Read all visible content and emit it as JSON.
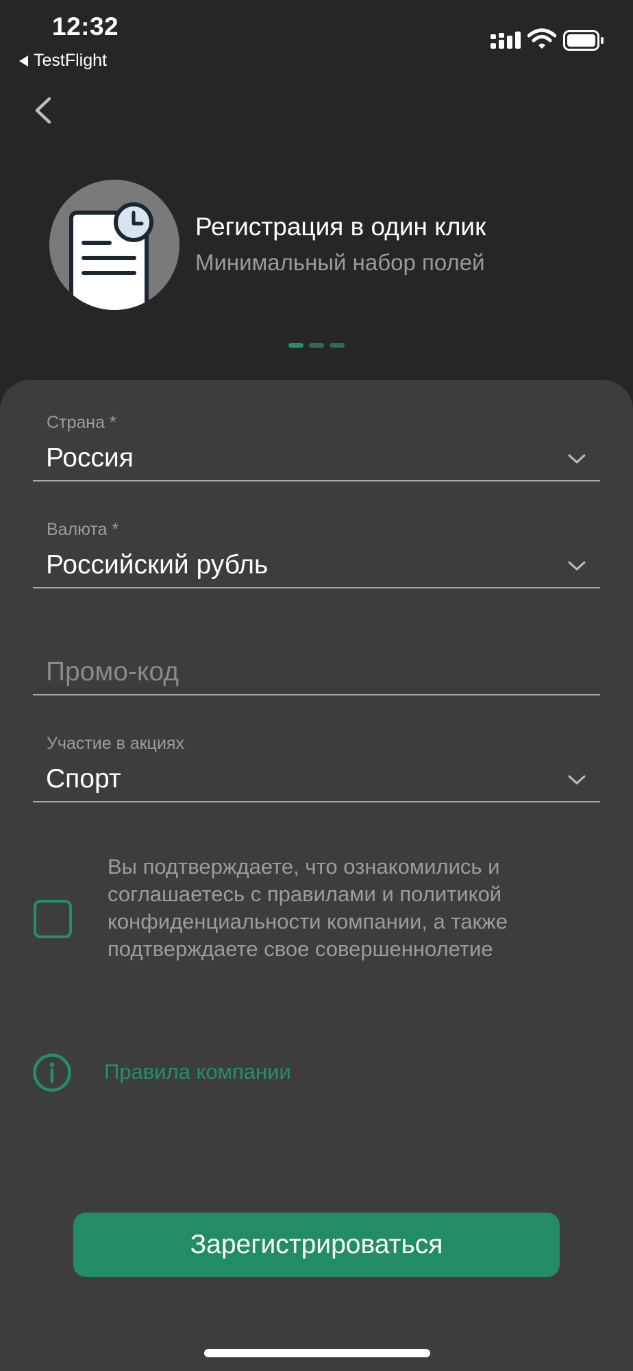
{
  "status_bar": {
    "time": "12:32",
    "back_app_label": "TestFlight",
    "icons": [
      "signal-icon",
      "wifi-icon",
      "battery-icon"
    ]
  },
  "hero": {
    "icon": "document-clock-icon",
    "title": "Регистрация в один клик",
    "subtitle": "Минимальный набор полей",
    "pager": {
      "total": 3,
      "active_index": 0
    }
  },
  "form": {
    "country": {
      "label": "Страна *",
      "value": "Россия"
    },
    "currency": {
      "label": "Валюта *",
      "value": "Российский рубль"
    },
    "promo": {
      "placeholder": "Промо-код"
    },
    "promotions": {
      "label": "Участие в акциях",
      "value": "Спорт"
    },
    "consent": {
      "checked": false,
      "text": "Вы подтверждаете, что ознакомились и соглашаетесь с правилами и политикой конфиденциальности компании, а также подтверждаете свое совершеннолетие"
    },
    "rules_link": "Правила компании",
    "submit_label": "Зарегистрироваться"
  },
  "colors": {
    "background": "#262626",
    "sheet": "#3d3d3d",
    "accent": "#23906a",
    "button": "#228c64",
    "muted_text": "#9c9c9c"
  }
}
